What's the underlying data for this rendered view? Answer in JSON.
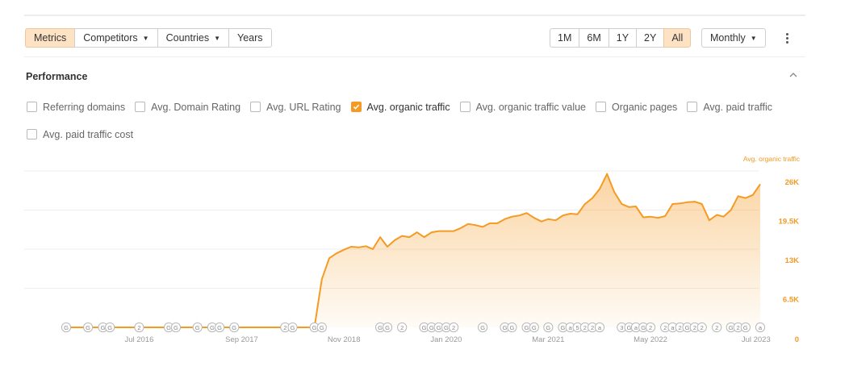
{
  "toolbar": {
    "tabs": [
      {
        "label": "Metrics",
        "active": true,
        "dropdown": false
      },
      {
        "label": "Competitors",
        "active": false,
        "dropdown": true
      },
      {
        "label": "Countries",
        "active": false,
        "dropdown": true
      },
      {
        "label": "Years",
        "active": false,
        "dropdown": false
      }
    ],
    "ranges": [
      {
        "label": "1M",
        "active": false
      },
      {
        "label": "6M",
        "active": false
      },
      {
        "label": "1Y",
        "active": false
      },
      {
        "label": "2Y",
        "active": false
      },
      {
        "label": "All",
        "active": true
      }
    ],
    "granularity": "Monthly"
  },
  "section": {
    "title": "Performance",
    "metrics": [
      {
        "label": "Referring domains",
        "checked": false
      },
      {
        "label": "Avg. Domain Rating",
        "checked": false
      },
      {
        "label": "Avg. URL Rating",
        "checked": false
      },
      {
        "label": "Avg. organic traffic",
        "checked": true
      },
      {
        "label": "Avg. organic traffic value",
        "checked": false
      },
      {
        "label": "Organic pages",
        "checked": false
      },
      {
        "label": "Avg. paid traffic",
        "checked": false
      },
      {
        "label": "Avg. paid traffic cost",
        "checked": false
      }
    ]
  },
  "colors": {
    "accent": "#f59a23",
    "accent_label": "#f29a26",
    "grid": "#eeeeee",
    "axis_text": "#999999"
  },
  "chart_data": {
    "type": "area",
    "series_label": "Avg. organic traffic",
    "series": [
      {
        "name": "Avg. organic traffic",
        "values": [
          [
            "2015-09",
            0
          ],
          [
            "2016-01",
            0
          ],
          [
            "2016-06",
            0
          ],
          [
            "2016-12",
            0
          ],
          [
            "2017-06",
            0
          ],
          [
            "2017-12",
            0
          ],
          [
            "2018-05",
            0
          ],
          [
            "2018-06",
            0
          ],
          [
            "2018-07",
            0
          ],
          [
            "2018-08",
            8000
          ],
          [
            "2018-09",
            11500
          ],
          [
            "2018-10",
            12300
          ],
          [
            "2018-11",
            12900
          ],
          [
            "2018-12",
            13400
          ],
          [
            "2019-01",
            13300
          ],
          [
            "2019-02",
            13500
          ],
          [
            "2019-03",
            13000
          ],
          [
            "2019-04",
            15000
          ],
          [
            "2019-05",
            13400
          ],
          [
            "2019-06",
            14500
          ],
          [
            "2019-07",
            15200
          ],
          [
            "2019-08",
            15000
          ],
          [
            "2019-09",
            15800
          ],
          [
            "2019-10",
            15000
          ],
          [
            "2019-11",
            15800
          ],
          [
            "2019-12",
            16000
          ],
          [
            "2020-01",
            16000
          ],
          [
            "2020-02",
            16000
          ],
          [
            "2020-03",
            16500
          ],
          [
            "2020-04",
            17200
          ],
          [
            "2020-05",
            17000
          ],
          [
            "2020-06",
            16700
          ],
          [
            "2020-07",
            17300
          ],
          [
            "2020-08",
            17300
          ],
          [
            "2020-09",
            18000
          ],
          [
            "2020-10",
            18400
          ],
          [
            "2020-11",
            18600
          ],
          [
            "2020-12",
            19000
          ],
          [
            "2021-01",
            18200
          ],
          [
            "2021-02",
            17600
          ],
          [
            "2021-03",
            18000
          ],
          [
            "2021-04",
            17800
          ],
          [
            "2021-05",
            18600
          ],
          [
            "2021-06",
            18900
          ],
          [
            "2021-07",
            18800
          ],
          [
            "2021-08",
            20500
          ],
          [
            "2021-09",
            21500
          ],
          [
            "2021-10",
            23000
          ],
          [
            "2021-11",
            25500
          ],
          [
            "2021-12",
            22500
          ],
          [
            "2022-01",
            20500
          ],
          [
            "2022-02",
            20000
          ],
          [
            "2022-03",
            20100
          ],
          [
            "2022-04",
            18300
          ],
          [
            "2022-05",
            18400
          ],
          [
            "2022-06",
            18200
          ],
          [
            "2022-07",
            18500
          ],
          [
            "2022-08",
            20500
          ],
          [
            "2022-09",
            20600
          ],
          [
            "2022-10",
            20800
          ],
          [
            "2022-11",
            20900
          ],
          [
            "2022-12",
            20500
          ],
          [
            "2023-01",
            17800
          ],
          [
            "2023-02",
            18700
          ],
          [
            "2023-03",
            18400
          ],
          [
            "2023-04",
            19500
          ],
          [
            "2023-05",
            21800
          ],
          [
            "2023-06",
            21500
          ],
          [
            "2023-07",
            22000
          ],
          [
            "2023-08",
            23800
          ]
        ]
      }
    ],
    "x_ticks": [
      "Jul 2016",
      "Sep 2017",
      "Nov 2018",
      "Jan 2020",
      "Mar 2021",
      "May 2022",
      "Jul 2023"
    ],
    "y_ticks": [
      "0",
      "6.5K",
      "13K",
      "19.5K",
      "26K"
    ],
    "ylim": [
      0,
      26000
    ],
    "grid": true,
    "legend": "top-right",
    "annotations": [
      [
        "2015-09",
        "G"
      ],
      [
        "2015-12",
        "G"
      ],
      [
        "2016-02",
        "G"
      ],
      [
        "2016-03",
        "G"
      ],
      [
        "2016-07",
        "2"
      ],
      [
        "2016-11",
        "G"
      ],
      [
        "2016-12",
        "G"
      ],
      [
        "2017-03",
        "G"
      ],
      [
        "2017-05",
        "G"
      ],
      [
        "2017-06",
        "G"
      ],
      [
        "2017-08",
        "G"
      ],
      [
        "2018-03",
        "2"
      ],
      [
        "2018-04",
        "G"
      ],
      [
        "2018-07",
        "G"
      ],
      [
        "2018-08",
        "G"
      ],
      [
        "2019-04",
        "G"
      ],
      [
        "2019-05",
        "G"
      ],
      [
        "2019-07",
        "2"
      ],
      [
        "2019-10",
        "G"
      ],
      [
        "2019-11",
        "G"
      ],
      [
        "2019-12",
        "G"
      ],
      [
        "2020-01",
        "G"
      ],
      [
        "2020-02",
        "2"
      ],
      [
        "2020-06",
        "G"
      ],
      [
        "2020-09",
        "G"
      ],
      [
        "2020-10",
        "G"
      ],
      [
        "2020-12",
        "G"
      ],
      [
        "2021-01",
        "G"
      ],
      [
        "2021-03",
        "G"
      ],
      [
        "2021-05",
        "G"
      ],
      [
        "2021-06",
        "a"
      ],
      [
        "2021-07",
        "5"
      ],
      [
        "2021-08",
        "2"
      ],
      [
        "2021-09",
        "2"
      ],
      [
        "2021-10",
        "a"
      ],
      [
        "2022-01",
        "3"
      ],
      [
        "2022-02",
        "G"
      ],
      [
        "2022-03",
        "a"
      ],
      [
        "2022-04",
        "G"
      ],
      [
        "2022-05",
        "2"
      ],
      [
        "2022-07",
        "2"
      ],
      [
        "2022-08",
        "a"
      ],
      [
        "2022-09",
        "2"
      ],
      [
        "2022-10",
        "G"
      ],
      [
        "2022-11",
        "2"
      ],
      [
        "2022-12",
        "2"
      ],
      [
        "2023-02",
        "2"
      ],
      [
        "2023-04",
        "G"
      ],
      [
        "2023-05",
        "2"
      ],
      [
        "2023-06",
        "G"
      ],
      [
        "2023-08",
        "a"
      ]
    ]
  }
}
